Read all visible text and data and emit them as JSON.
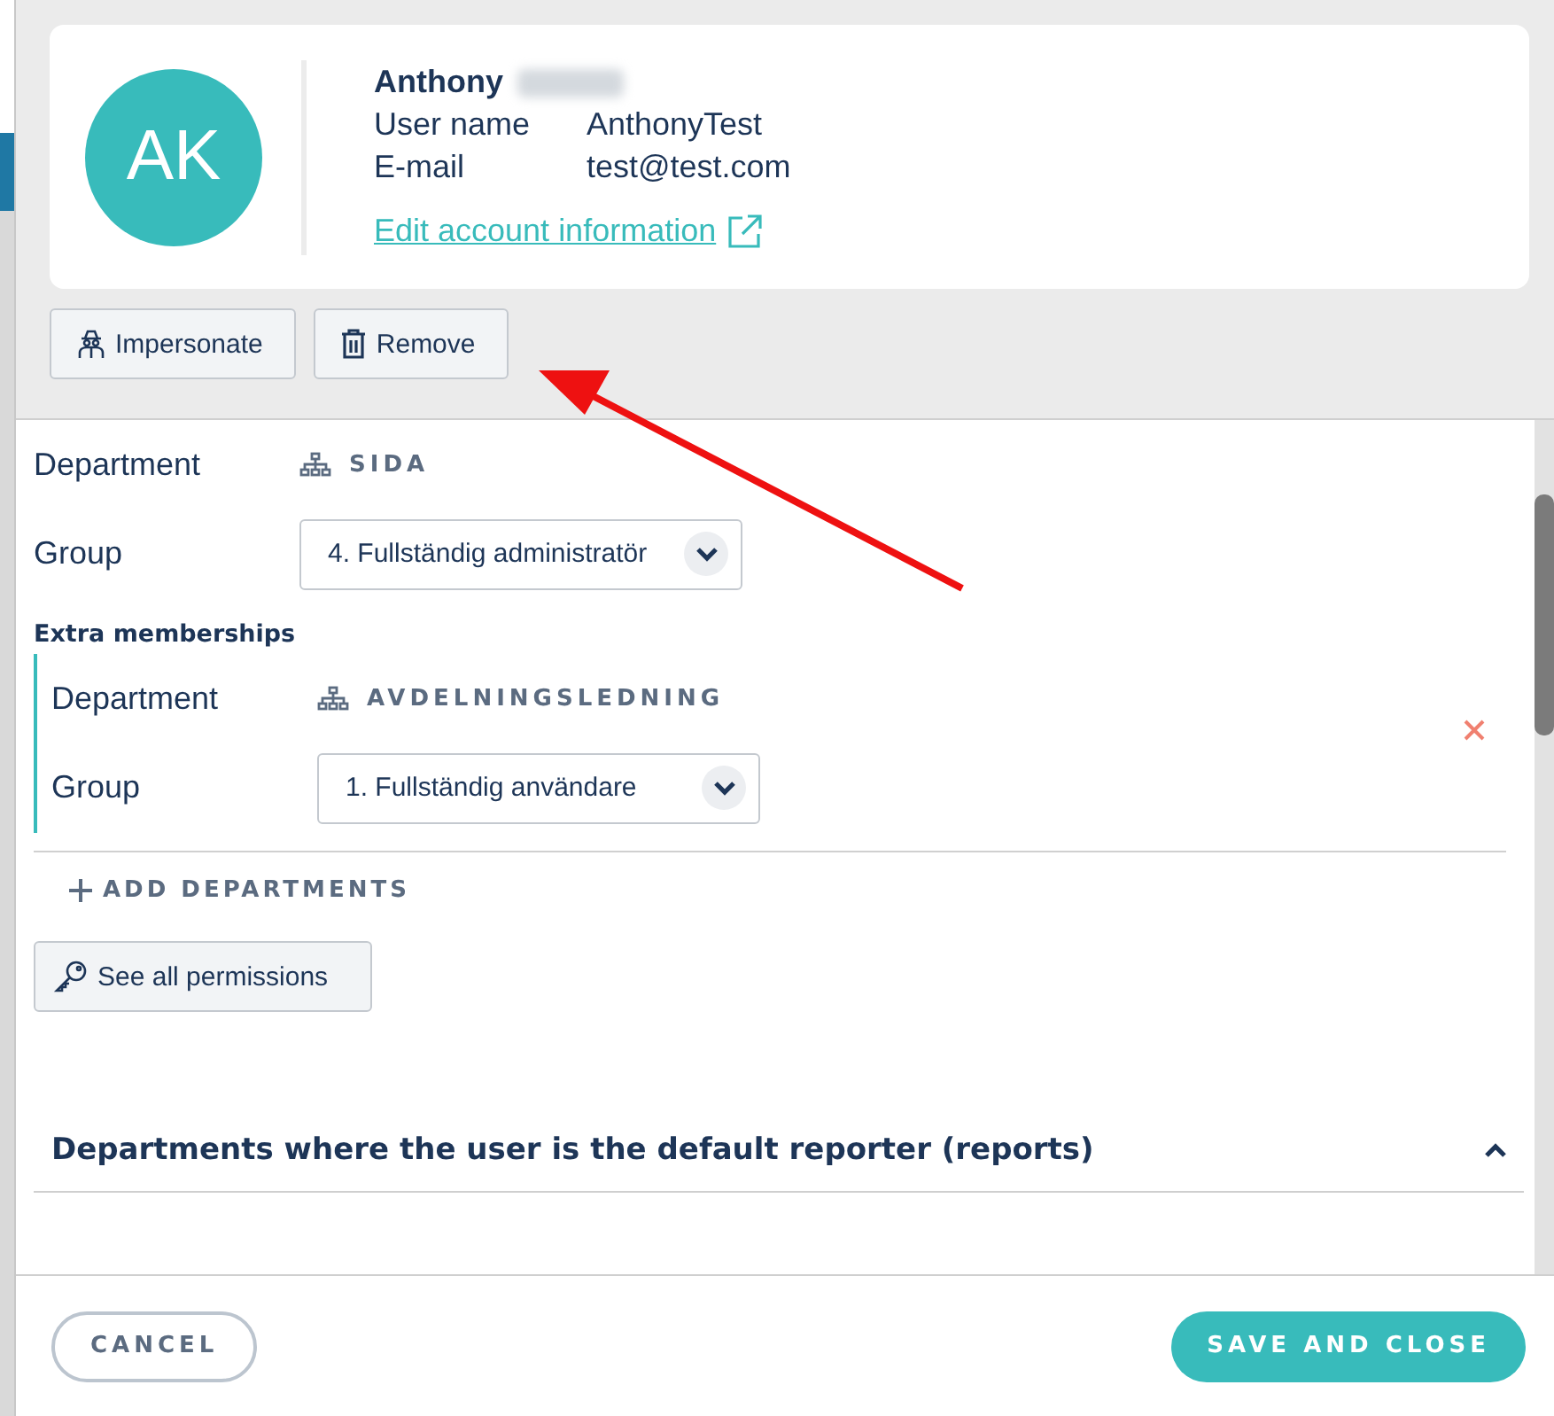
{
  "user": {
    "initials": "AK",
    "first_name": "Anthony",
    "surname_redacted": true,
    "fields": [
      {
        "label": "User name",
        "value": "AnthonyTest"
      },
      {
        "label": "E-mail",
        "value": "test@test.com"
      }
    ],
    "edit_link": "Edit account information"
  },
  "actions": [
    {
      "kind": "impersonate",
      "label": "Impersonate"
    },
    {
      "kind": "remove",
      "label": "Remove"
    }
  ],
  "membership": {
    "department_label": "Department",
    "department": "SIDA",
    "group_label": "Group",
    "group": "4. Fullständig administratör"
  },
  "extra_memberships": {
    "title": "Extra memberships",
    "items": [
      {
        "department_label": "Department",
        "department": "AVDELNINGSLEDNING",
        "group_label": "Group",
        "group": "1. Fullständig användare"
      }
    ]
  },
  "add_departments": "ADD DEPARTMENTS",
  "permissions_button": "See all permissions",
  "sections": [
    {
      "title": "Departments where the user is the default reporter (reports)",
      "expanded": true
    }
  ],
  "footer": {
    "cancel": "CANCEL",
    "save": "SAVE AND CLOSE"
  }
}
